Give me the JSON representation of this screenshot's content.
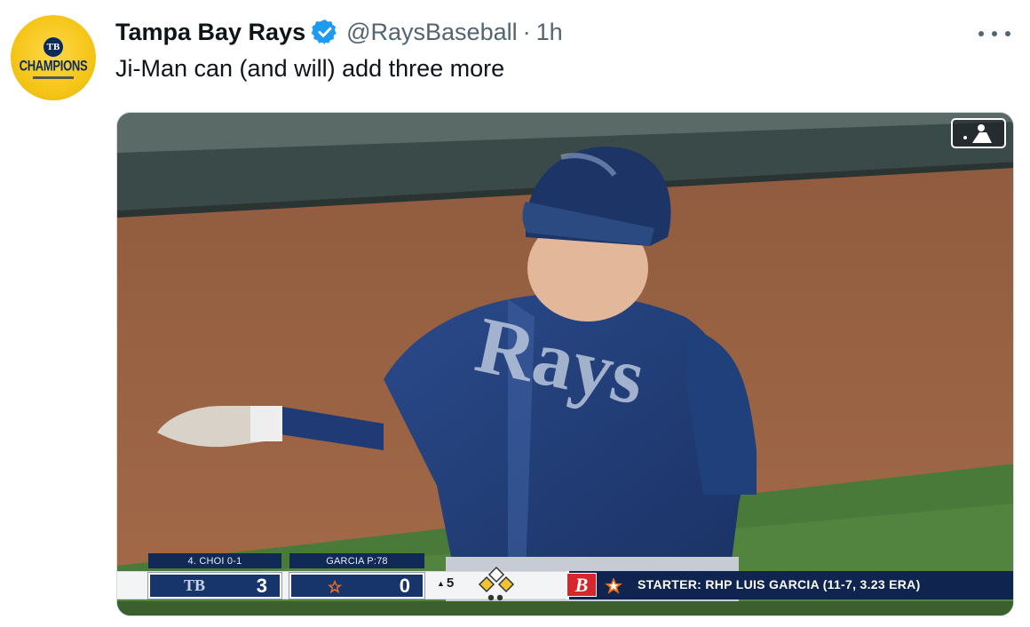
{
  "tweet": {
    "display_name": "Tampa Bay Rays",
    "handle": "@RaysBaseball",
    "separator": "·",
    "time": "1h",
    "text": "Ji-Man can (and will) add three more",
    "avatar": {
      "badge": "TB",
      "label": "CHAMPIONS"
    },
    "verified_color": "#1d9bf0"
  },
  "video": {
    "scorebug": {
      "batter_label": "4. CHOI 0-1",
      "pitcher_label": "GARCIA P:78",
      "home_team_logo": "TB",
      "home_score": "3",
      "away_score": "0",
      "inning": "5",
      "sponsor_logo": "B",
      "starter_text": "STARTER: RHP LUIS GARCIA (11-7, 3.23 ERA)"
    },
    "watermark_icon": "mlb-logo-icon"
  }
}
